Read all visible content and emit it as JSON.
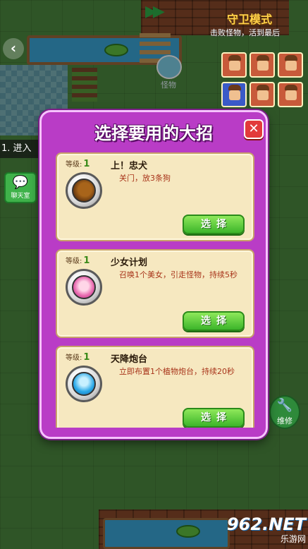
{
  "hud": {
    "mode_title": "守卫模式",
    "mode_subtitle": "击败怪物，活到最后",
    "monster_label": "怪物",
    "task_text": "1. 进入",
    "chat_label": "聊天室",
    "repair_label": "维修",
    "back_icon": "chevron-left-icon"
  },
  "dialog": {
    "title": "选择要用的大招",
    "close_icon": "close-x-icon",
    "skills": [
      {
        "level_label": "等级:",
        "level": "1",
        "name": "上！忠犬",
        "description": "关门，放3条狗",
        "icon": "dog-icon",
        "button": "选择"
      },
      {
        "level_label": "等级:",
        "level": "1",
        "name": "少女计划",
        "description": "召唤1个美女，引走怪物，持续5秒",
        "icon": "girl-icon",
        "button": "选择"
      },
      {
        "level_label": "等级:",
        "level": "1",
        "name": "天降炮台",
        "description": "立即布置1个植物炮台，持续20秒",
        "icon": "plant-turret-icon",
        "button": "选择"
      }
    ]
  },
  "watermark": {
    "big": "962.NET",
    "small": "乐游网"
  },
  "colors": {
    "dialog_bg": "#b93cc6",
    "card_bg": "#f6e8c0",
    "button_green": "#3cb52a",
    "close_red": "#e23a3a",
    "mode_title": "#ffd24a"
  }
}
